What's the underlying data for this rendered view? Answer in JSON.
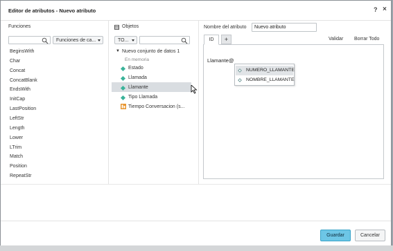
{
  "dialog": {
    "title": "Editor de atributos - Nuevo atributo",
    "help_label": "?",
    "close_label": "×"
  },
  "functions": {
    "heading": "Funciones",
    "search_placeholder": "",
    "category_select": "Funciones de ca...",
    "items": [
      "BeginsWith",
      "Char",
      "Concat",
      "ConcatBlank",
      "EndsWith",
      "InitCap",
      "LastPosition",
      "LeftStr",
      "Length",
      "Lower",
      "LTrim",
      "Match",
      "Position",
      "RepeatStr"
    ]
  },
  "objects": {
    "heading": "Objetos",
    "filter_select": "TO...",
    "search_placeholder": "",
    "dataset_name": "Nuevo conjunto de datos 1",
    "dataset_sub": "En memoria",
    "items": [
      "Estado",
      "Llamada",
      "Llamante",
      "Tipo Llamada",
      "Tiempo Conversacion (s..."
    ]
  },
  "attribute": {
    "name_label": "Nombre del atributo",
    "name_value": "Nuevo atributo",
    "tab_id": "ID",
    "tab_add": "+",
    "validate": "Validar",
    "clear_all": "Borrar Todo",
    "expression": "Llamante@"
  },
  "autocomplete": {
    "items": [
      "NUMERO_LLAMANTE",
      "NOMBRE_LLAMANTE"
    ]
  },
  "footer": {
    "save": "Guardar",
    "cancel": "Cancelar"
  },
  "colors": {
    "accent": "#5bc0de",
    "metric_icon": "#3bb39a",
    "calc_icon": "#e8952f"
  }
}
